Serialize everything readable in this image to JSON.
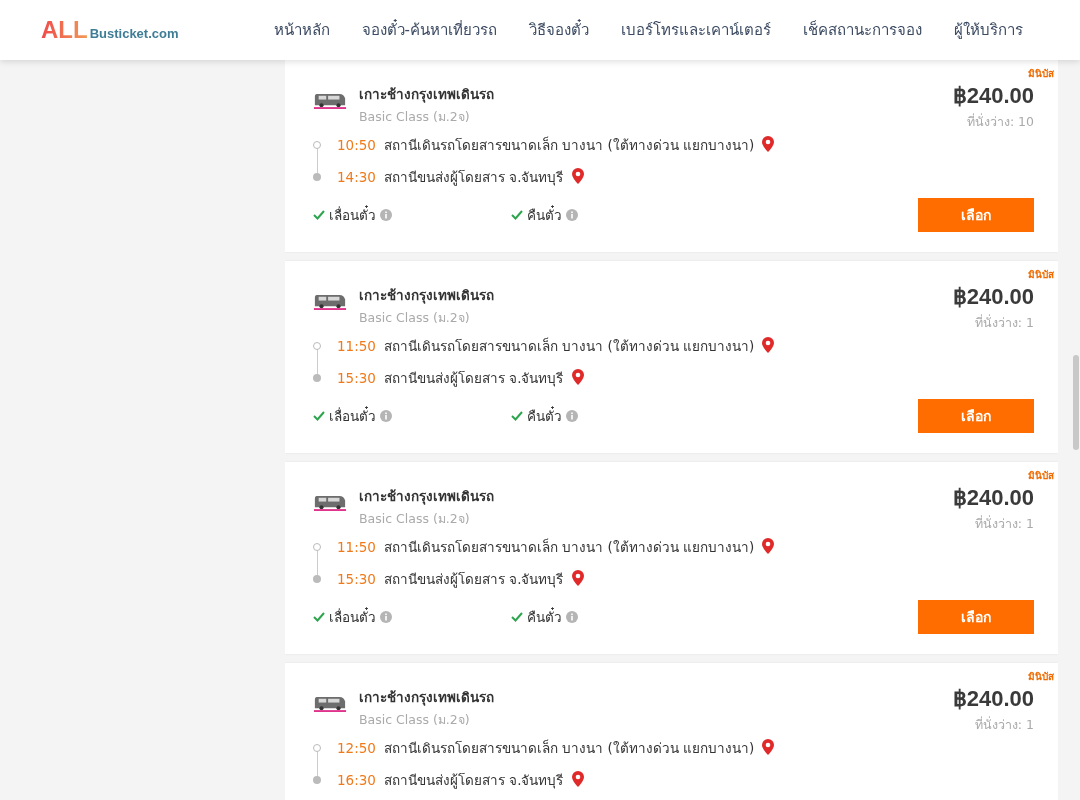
{
  "header": {
    "logo": {
      "brand": "ALL",
      "domain": "Busticket.com"
    },
    "nav": [
      "หน้าหลัก",
      "จองตั๋ว-ค้นหาเที่ยวรถ",
      "วิธีจองตั๋ว",
      "เบอร์โทรและเคาน์เตอร์",
      "เช็คสถานะการจอง",
      "ผู้ให้บริการ"
    ]
  },
  "trips": [
    {
      "badge": "มินิบัส",
      "operator": "เกาะช้างกรุงเทพเดินรถ",
      "class": "Basic Class (ม.2จ)",
      "stops": [
        {
          "time": "10:50",
          "place": "สถานีเดินรถโดยสารขนาดเล็ก บางนา (ใต้ทางด่วน แยกบางนา)"
        },
        {
          "time": "14:30",
          "place": "สถานีขนส่งผู้โดยสาร จ.จันทบุรี"
        }
      ],
      "features": [
        "เลื่อนตั๋ว",
        "คืนตั๋ว"
      ],
      "price": "฿240.00",
      "seats": "ที่นั่งว่าง: 10",
      "button": "เลือก"
    },
    {
      "badge": "มินิบัส",
      "operator": "เกาะช้างกรุงเทพเดินรถ",
      "class": "Basic Class (ม.2จ)",
      "stops": [
        {
          "time": "11:50",
          "place": "สถานีเดินรถโดยสารขนาดเล็ก บางนา (ใต้ทางด่วน แยกบางนา)"
        },
        {
          "time": "15:30",
          "place": "สถานีขนส่งผู้โดยสาร จ.จันทบุรี"
        }
      ],
      "features": [
        "เลื่อนตั๋ว",
        "คืนตั๋ว"
      ],
      "price": "฿240.00",
      "seats": "ที่นั่งว่าง: 1",
      "button": "เลือก"
    },
    {
      "badge": "มินิบัส",
      "operator": "เกาะช้างกรุงเทพเดินรถ",
      "class": "Basic Class (ม.2จ)",
      "stops": [
        {
          "time": "11:50",
          "place": "สถานีเดินรถโดยสารขนาดเล็ก บางนา (ใต้ทางด่วน แยกบางนา)"
        },
        {
          "time": "15:30",
          "place": "สถานีขนส่งผู้โดยสาร จ.จันทบุรี"
        }
      ],
      "features": [
        "เลื่อนตั๋ว",
        "คืนตั๋ว"
      ],
      "price": "฿240.00",
      "seats": "ที่นั่งว่าง: 1",
      "button": "เลือก"
    },
    {
      "badge": "มินิบัส",
      "operator": "เกาะช้างกรุงเทพเดินรถ",
      "class": "Basic Class (ม.2จ)",
      "stops": [
        {
          "time": "12:50",
          "place": "สถานีเดินรถโดยสารขนาดเล็ก บางนา (ใต้ทางด่วน แยกบางนา)"
        },
        {
          "time": "16:30",
          "place": "สถานีขนส่งผู้โดยสาร จ.จันทบุรี"
        }
      ],
      "price": "฿240.00",
      "seats": "ที่นั่งว่าง: 1"
    }
  ]
}
